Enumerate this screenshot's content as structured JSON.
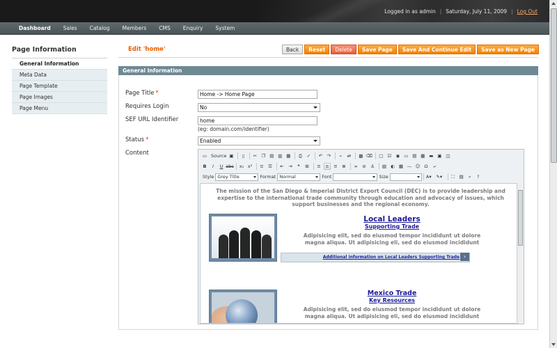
{
  "header": {
    "logged_in": "Logged in as admin",
    "date": "Saturday, July 11, 2009",
    "logout": "Log Out"
  },
  "nav": {
    "items": [
      "Dashboard",
      "Sales",
      "Catalog",
      "Members",
      "CMS",
      "Enquiry",
      "System"
    ]
  },
  "sidebar": {
    "title": "Page Information",
    "items": [
      "General Information",
      "Meta Data",
      "Page Template",
      "Page Images",
      "Page Menu"
    ]
  },
  "page": {
    "title": "Edit 'home'",
    "buttons": {
      "back": "Back",
      "reset": "Reset",
      "delete": "Delete",
      "save": "Save Page",
      "save_continue": "Save And Continue Edit",
      "save_new": "Save as New Page"
    },
    "section_title": "General Information"
  },
  "form": {
    "page_title_label": "Page Title",
    "page_title_value": "Home -> Home Page",
    "requires_login_label": "Requires Login",
    "requires_login_value": "No",
    "sef_label": "SEF URL Identifier",
    "sef_value": "home",
    "sef_hint": "(eg: domain.com/identifier)",
    "status_label": "Status",
    "status_value": "Enabled",
    "content_label": "Content",
    "required_mark": "*"
  },
  "editor": {
    "source_label": "Source",
    "style_label": "Style",
    "style_value": "Grey Title",
    "format_label": "Format",
    "format_value": "Normal",
    "font_label": "Font",
    "font_value": "",
    "size_label": "Size",
    "size_value": ""
  },
  "content": {
    "mission": "The mission of the San Diego & Imperial District Export Council (DEC) is to provide leadership and expertise to the international trade community through education and advocacy of issues, which support businesses and the regional economy.",
    "block1": {
      "heading": "Local Leaders",
      "subheading": "Supporting Trade",
      "text": "Adipisicing elit, sed do eiusmod tempor incididunt ut dolore magna aliqua. Ut adipisicing eli, sed do eiusmod incididunt",
      "link": "Additional information on Local Leaders Supporting Trade"
    },
    "block2": {
      "heading": "Mexico Trade",
      "subheading": "Key Resources",
      "text": "Adipisicing elit, sed do eiusmod tempor incididunt ut dolore magna aliqua. Ut adipisicing eli, sed do eiusmod incididunt"
    }
  },
  "colors": {
    "accent_orange": "#f18200",
    "title_orange": "#eb5e00",
    "section_header": "#6f8992",
    "link_blue": "#1a1a99"
  }
}
